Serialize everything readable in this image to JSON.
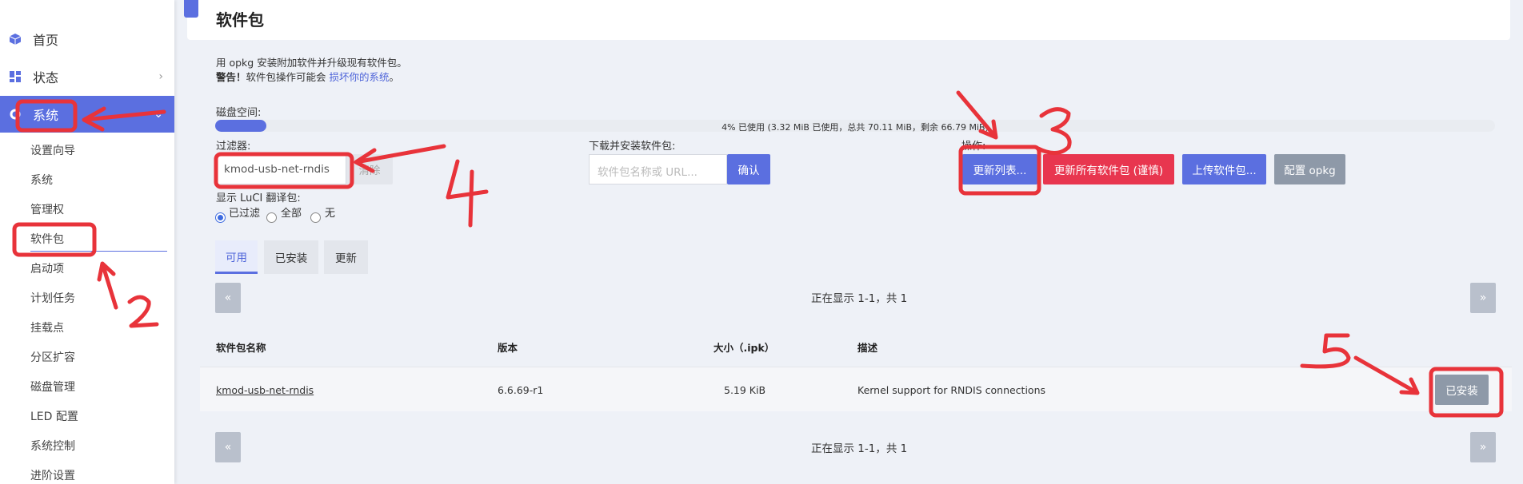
{
  "sidebar": {
    "home": "首页",
    "status": "状态",
    "system": "系统",
    "sub_items": [
      "设置向导",
      "系统",
      "管理权",
      "软件包",
      "启动项",
      "计划任务",
      "挂载点",
      "分区扩容",
      "磁盘管理",
      "LED 配置",
      "系统控制",
      "进阶设置"
    ]
  },
  "page": {
    "title": "软件包",
    "desc_line1": "用 opkg 安装附加软件并升级现有软件包。",
    "warning_bold": "警告！",
    "warning_text": "软件包操作可能会 ",
    "warning_link": "损坏你的系统",
    "warning_end": "。"
  },
  "disk": {
    "label": "磁盘空间:",
    "used_fraction": 0.04,
    "text": "4% 已使用 (3.32 MiB 已使用，总共 70.11 MiB，剩余 66.79 MiB)"
  },
  "filter": {
    "label": "过滤器:",
    "value": "kmod-usb-net-rndis",
    "clear_button": "清除"
  },
  "download": {
    "label": "下载并安装软件包:",
    "placeholder": "软件包名称或 URL...",
    "confirm_button": "确认"
  },
  "actions": {
    "label": "操作:",
    "update_lists": "更新列表...",
    "upgrade_all": "更新所有软件包 (谨慎)",
    "upload": "上传软件包...",
    "configure": "配置 opkg"
  },
  "luci_translation": {
    "label": "显示 LuCI 翻译包:",
    "options": [
      "已过滤",
      "全部",
      "无"
    ],
    "selected": "已过滤"
  },
  "tabs": [
    "可用",
    "已安装",
    "更新"
  ],
  "pager": {
    "prev": "«",
    "next": "»",
    "text": "正在显示 1-1，共 1"
  },
  "table": {
    "headers": [
      "软件包名称",
      "版本",
      "大小（.ipk）",
      "描述"
    ],
    "rows": [
      {
        "name": "kmod-usb-net-rndis",
        "version": "6.6.69-r1",
        "size": "5.19 KiB",
        "description": "Kernel support for RNDIS connections",
        "action": "已安装"
      }
    ]
  },
  "colors": {
    "accent": "#5b6fe0",
    "danger": "#e8364f",
    "secondary": "#8e99a8",
    "annotation": "#e8333a"
  },
  "annotations": [
    "2",
    "3",
    "4",
    "5"
  ]
}
